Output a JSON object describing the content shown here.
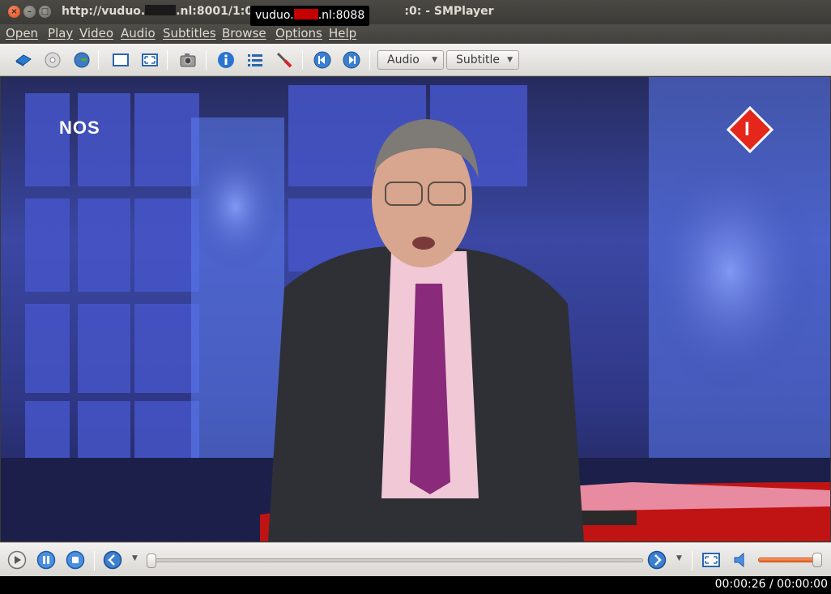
{
  "window": {
    "title_prefix": "http://vuduo.",
    "title_middle": ".nl:8001/1:0:1",
    "title_suffix": ":0: - SMPlayer",
    "tooltip_prefix": "vuduo.",
    "tooltip_suffix": ".nl:8088"
  },
  "menu": [
    "Open",
    "Play",
    "Video",
    "Audio",
    "Subtitles",
    "Browse",
    "Options",
    "Help"
  ],
  "toolbar": {
    "audio_label": "Audio",
    "subtitle_label": "Subtitle"
  },
  "video": {
    "channel_logo": "NOS",
    "logo_badge": "I"
  },
  "playback": {
    "progress": 0.0,
    "volume": 1.0,
    "time": "00:00:26 / 00:00:00"
  },
  "colors": {
    "volume_fill": "#e8601e",
    "nos_logo": "#ffffff",
    "badge_red": "#e4261b"
  }
}
